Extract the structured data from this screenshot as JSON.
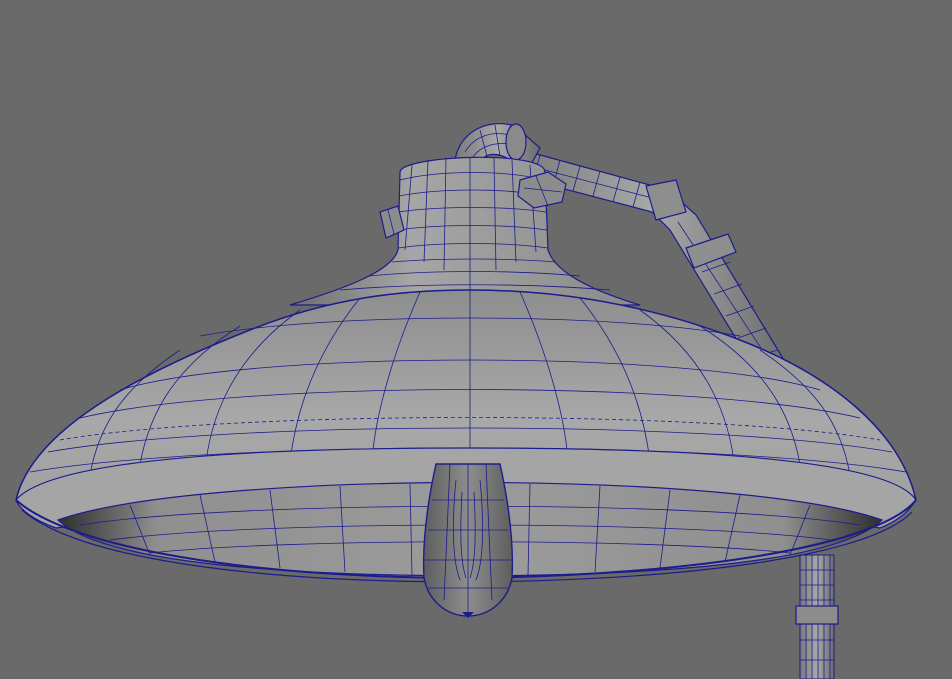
{
  "viewport": {
    "background": "#6a6a6a",
    "wire_color": "#1c1c8c",
    "surface_light": "#a3a3a3",
    "surface_mid": "#8a8a8a",
    "surface_dark": "#4a4a4a"
  },
  "model": {
    "subject": "industrial-lamp-shade-wireframe",
    "parts": [
      "lamp-shade",
      "shade-neck",
      "pipe-elbow",
      "pipe-arm",
      "pipe-stand",
      "light-bulb",
      "nut-bolts"
    ]
  }
}
